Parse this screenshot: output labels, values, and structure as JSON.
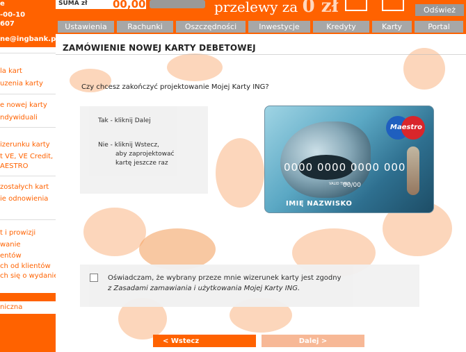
{
  "sidebar": {
    "top_lines": [
      "e",
      "-00-10",
      "607"
    ],
    "email": "ne@ingbank.pl",
    "items": [
      "la kart",
      "uzenia karty",
      "e nowej karty",
      "ndywiduali",
      "izerunku karty",
      "t VE, VE Credit,",
      "AESTRO",
      "zostałych kart",
      "ie odnowienia",
      "t i prowizji",
      "wanie",
      "entów",
      "ch od klientów",
      "ch się o wydanie"
    ],
    "bottom_item": "niczna"
  },
  "banner": {
    "suma_label": "SUMA zł",
    "suma_value": "00,00",
    "promo_text": "przelewy za",
    "promo_big": "0 zł",
    "refresh_label": "Odśwież"
  },
  "nav": {
    "tabs": [
      "Ustawienia",
      "Rachunki",
      "Oszczędności",
      "Inwestycje",
      "Kredyty",
      "Karty",
      "Portal"
    ]
  },
  "page": {
    "title": "ZAMÓWIENIE NOWEJ KARTY DEBETOWEJ",
    "question": "Czy chcesz zakończyć projektowanie Mojej Karty ING?",
    "option_yes": "Tak - kliknij Dalej",
    "option_no_lines": [
      "Nie - kliknij Wstecz,",
      "aby zaprojektować",
      "kartę jeszcze raz"
    ]
  },
  "card": {
    "brand": "Maestro",
    "number": "0000 0000 0000 000",
    "exp_label": "VALID THRU",
    "exp_value": "00/00",
    "holder_name": "IMIĘ NAZWISKO"
  },
  "declaration": {
    "checked": false,
    "text_line1": "Oświadczam, że wybrany przeze mnie wizerunek karty jest zgodny",
    "text_line2": "z Zasadami zamawiania i użytkowania Mojej Karty ING."
  },
  "buttons": {
    "back": "< Wstecz",
    "next": "Dalej >"
  }
}
